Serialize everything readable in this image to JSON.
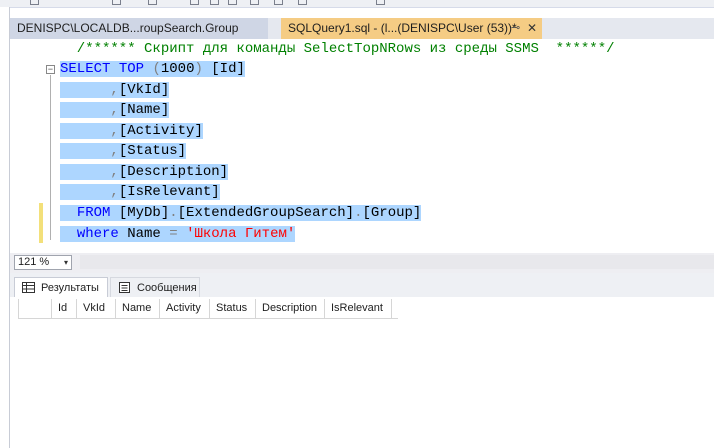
{
  "tabs": {
    "inactive_label": "DENISPC\\LOCALDB...roupSearch.Group",
    "active_label": "SQLQuery1.sql - (l...(DENISPC\\User (53))*",
    "pin_glyph": "⊸",
    "close_glyph": "✕"
  },
  "editor": {
    "lines": [
      {
        "parts": [
          {
            "t": "  /****** Скрипт для команды SelectTopNRows из среды SSMS  ******/",
            "c": "cm"
          }
        ],
        "sel": false
      },
      {
        "parts": [
          {
            "t": "SELECT",
            "c": "kw"
          },
          {
            "t": " ",
            "c": "tx"
          },
          {
            "t": "TOP",
            "c": "kw"
          },
          {
            "t": " ",
            "c": "tx"
          },
          {
            "t": "(",
            "c": "gr"
          },
          {
            "t": "1000",
            "c": "tx"
          },
          {
            "t": ")",
            "c": "gr"
          },
          {
            "t": " [Id]",
            "c": "tx"
          }
        ],
        "sel": true
      },
      {
        "parts": [
          {
            "t": "      ",
            "c": "tx"
          },
          {
            "t": ",",
            "c": "gr"
          },
          {
            "t": "[VkId]",
            "c": "tx"
          }
        ],
        "sel": true
      },
      {
        "parts": [
          {
            "t": "      ",
            "c": "tx"
          },
          {
            "t": ",",
            "c": "gr"
          },
          {
            "t": "[Name]",
            "c": "tx"
          }
        ],
        "sel": true
      },
      {
        "parts": [
          {
            "t": "      ",
            "c": "tx"
          },
          {
            "t": ",",
            "c": "gr"
          },
          {
            "t": "[Activity]",
            "c": "tx"
          }
        ],
        "sel": true
      },
      {
        "parts": [
          {
            "t": "      ",
            "c": "tx"
          },
          {
            "t": ",",
            "c": "gr"
          },
          {
            "t": "[Status]",
            "c": "tx"
          }
        ],
        "sel": true
      },
      {
        "parts": [
          {
            "t": "      ",
            "c": "tx"
          },
          {
            "t": ",",
            "c": "gr"
          },
          {
            "t": "[Description]",
            "c": "tx"
          }
        ],
        "sel": true
      },
      {
        "parts": [
          {
            "t": "      ",
            "c": "tx"
          },
          {
            "t": ",",
            "c": "gr"
          },
          {
            "t": "[IsRelevant]",
            "c": "tx"
          }
        ],
        "sel": true
      },
      {
        "parts": [
          {
            "t": "  ",
            "c": "tx"
          },
          {
            "t": "FROM",
            "c": "kw"
          },
          {
            "t": " [MyDb]",
            "c": "tx"
          },
          {
            "t": ".",
            "c": "gr"
          },
          {
            "t": "[ExtendedGroupSearch]",
            "c": "tx"
          },
          {
            "t": ".",
            "c": "gr"
          },
          {
            "t": "[Group]",
            "c": "tx"
          }
        ],
        "sel": true
      },
      {
        "parts": [
          {
            "t": "  ",
            "c": "tx"
          },
          {
            "t": "where",
            "c": "kw"
          },
          {
            "t": " Name ",
            "c": "tx"
          },
          {
            "t": "=",
            "c": "gr"
          },
          {
            "t": " ",
            "c": "tx"
          },
          {
            "t": "'Школа Гитем'",
            "c": "st"
          }
        ],
        "sel": true
      }
    ],
    "collapse_glyph": "−"
  },
  "statusbar": {
    "zoom_value": "121 %",
    "zoom_arrow": "▾"
  },
  "results": {
    "tab_results": "Результаты",
    "tab_messages": "Сообщения",
    "columns": [
      "Id",
      "VkId",
      "Name",
      "Activity",
      "Status",
      "Description",
      "IsRelevant"
    ]
  },
  "colors": {
    "selection": "#add6ff",
    "keyword": "#0000ff",
    "comment": "#008000",
    "string": "#ff0000",
    "active_tab": "#f5cc84"
  }
}
